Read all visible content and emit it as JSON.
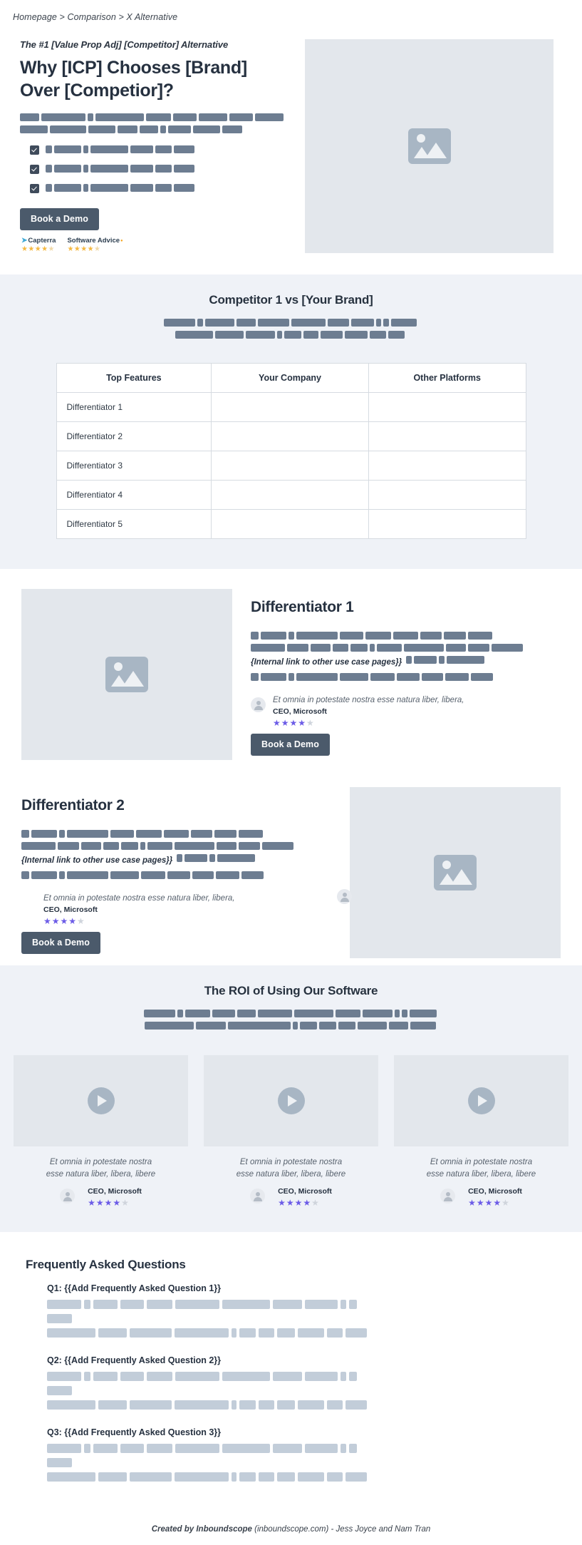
{
  "breadcrumb": "Homepage > Comparison > X Alternative",
  "hero": {
    "eyebrow": "The #1 [Value Prop Adj]  [Competitor] Alternative",
    "headline_line1": "Why [ICP] Chooses [Brand]",
    "headline_line2": "Over [Competior]?",
    "cta_label": "Book a Demo",
    "image_icon": "image-placeholder-icon",
    "badges": [
      {
        "name": "Capterra",
        "mark": "capterra-logo-icon",
        "stars": 4.5
      },
      {
        "name": "Software Advice",
        "mark": "software-advice-logo-icon",
        "stars": 4.5
      }
    ]
  },
  "comparison": {
    "title": "Competitor 1 vs [Your Brand]",
    "table": {
      "headers": [
        "Top Features",
        "Your Company",
        "Other Platforms"
      ],
      "rows": [
        {
          "feature": "Differentiator 1",
          "your_company": "",
          "other_platforms": ""
        },
        {
          "feature": "Differentiator 2",
          "your_company": "",
          "other_platforms": ""
        },
        {
          "feature": "Differentiator 3",
          "your_company": "",
          "other_platforms": ""
        },
        {
          "feature": "Differentiator 4",
          "your_company": "",
          "other_platforms": ""
        },
        {
          "feature": "Differentiator 5",
          "your_company": "",
          "other_platforms": ""
        }
      ]
    }
  },
  "differentiators": [
    {
      "title": "Differentiator 1",
      "internal_link": "{Internal link to other use case pages}}",
      "quote": "Et omnia in potestate nostra esse natura liber, libera,",
      "role": "CEO, Microsoft",
      "stars": 4,
      "cta_label": "Book a Demo",
      "image_icon": "image-placeholder-icon"
    },
    {
      "title": "Differentiator 2",
      "internal_link": "{Internal link to other use case pages}}",
      "quote": "Et omnia in potestate nostra esse natura liber, libera,",
      "role": "CEO, Microsoft",
      "stars": 4,
      "cta_label": "Book a Demo",
      "image_icon": "image-placeholder-icon"
    }
  ],
  "roi": {
    "title": "The ROI of Using Our Software",
    "cards": [
      {
        "quote_line1": "Et omnia in potestate nostra",
        "quote_line2": "esse natura liber, libera, libere",
        "role": "CEO, Microsoft",
        "stars": 4,
        "media_icon": "play-button-icon"
      },
      {
        "quote_line1": "Et omnia in potestate nostra",
        "quote_line2": "esse natura liber, libera, libere",
        "role": "CEO, Microsoft",
        "stars": 4,
        "media_icon": "play-button-icon"
      },
      {
        "quote_line1": "Et omnia in potestate nostra",
        "quote_line2": "esse natura liber, libera, libere",
        "role": "CEO, Microsoft",
        "stars": 4,
        "media_icon": "play-button-icon"
      }
    ]
  },
  "faq": {
    "title": "Frequently Asked Questions",
    "items": [
      {
        "question": "Q1: {{Add Frequently Asked Question 1}}"
      },
      {
        "question": "Q2: {{Add Frequently Asked Question 2}}"
      },
      {
        "question": "Q3: {{Add Frequently Asked Question 3}}"
      }
    ]
  },
  "footer": {
    "prefix": "Created by Inboundscope",
    "suffix": " (inboundscope.com) - Jess Joyce and Nam Tran"
  },
  "colors": {
    "skeleton_dark": "#6d7d91",
    "skeleton_light": "#c2cdd9",
    "section_bg": "#eff2f7",
    "media_bg": "#e3e7ec",
    "button_bg": "#4b5a6b",
    "star_purple": "#6c5ce7",
    "star_gold": "#f5b841",
    "heading": "#263140"
  }
}
